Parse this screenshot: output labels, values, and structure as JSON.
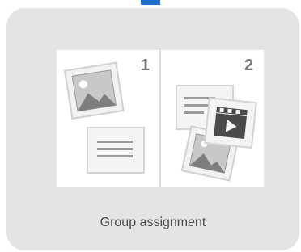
{
  "card": {
    "caption": "Group assignment",
    "panels": [
      {
        "number": "1",
        "icons": [
          "image-icon",
          "text-document-icon"
        ]
      },
      {
        "number": "2",
        "icons": [
          "text-document-icon",
          "video-icon",
          "image-icon"
        ]
      }
    ]
  },
  "colors": {
    "card_background": "#e4e4e4",
    "accent": "#1f6fd1",
    "icon_gray": "#8a8a8a",
    "number_gray": "#777777",
    "caption_text": "#4a4a4a"
  }
}
